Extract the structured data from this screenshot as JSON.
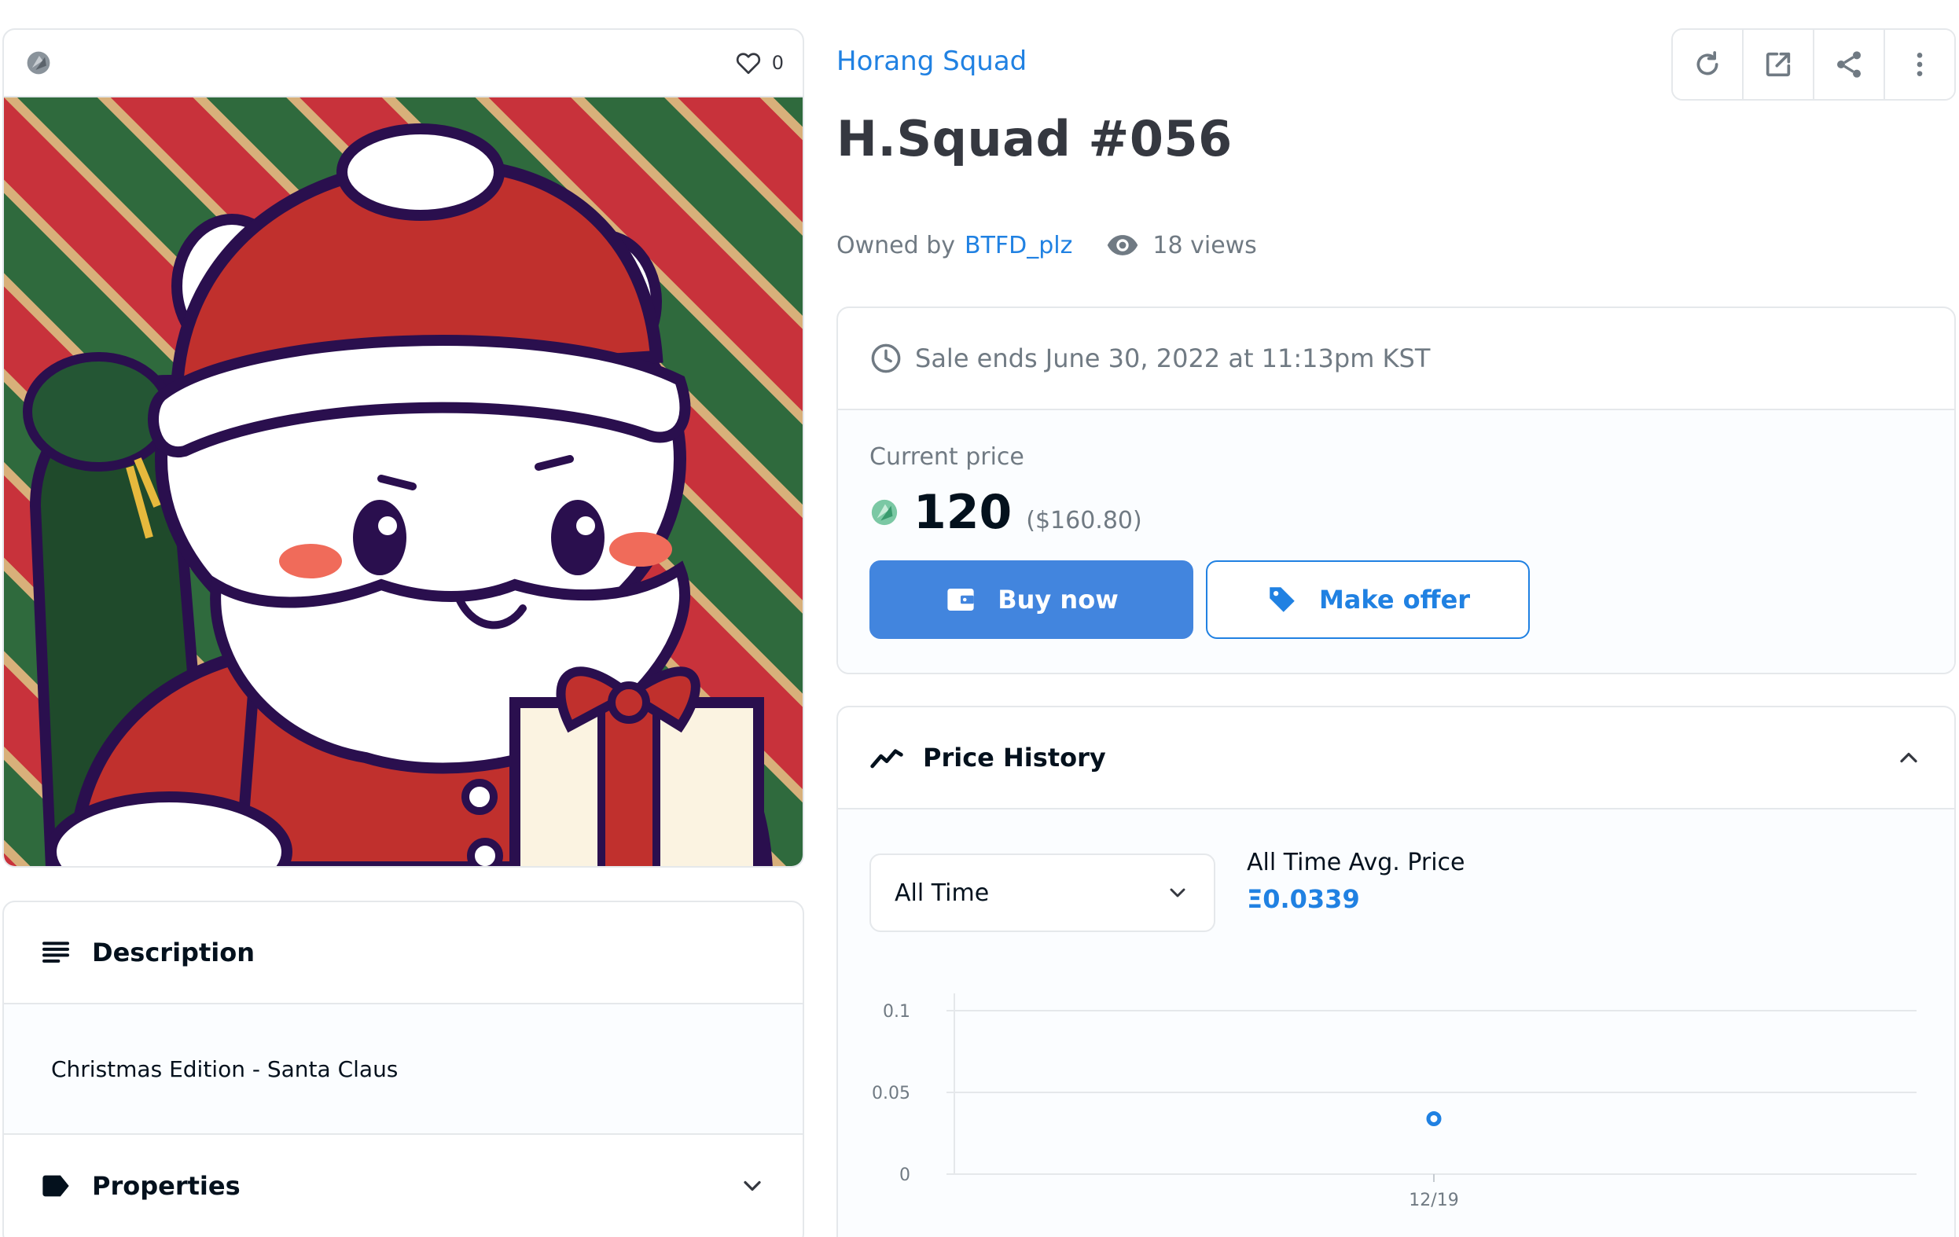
{
  "nft": {
    "favorites_count": "0"
  },
  "description": {
    "heading": "Description",
    "text": "Christmas Edition - Santa Claus"
  },
  "properties": {
    "heading": "Properties"
  },
  "collection": {
    "name": "Horang Squad"
  },
  "item": {
    "title": "H.Squad #056",
    "owned_by_label": "Owned by",
    "owner": "BTFD_plz",
    "views": "18 views"
  },
  "sale": {
    "ends_text": "Sale ends June 30, 2022 at 11:13pm KST",
    "current_price_label": "Current price",
    "price": "120",
    "price_fiat": "($160.80)",
    "buy_label": "Buy now",
    "offer_label": "Make offer"
  },
  "history": {
    "heading": "Price History",
    "range_selected": "All Time",
    "avg_label": "All Time Avg. Price",
    "avg_value": "Ξ0.0339"
  },
  "colors": {
    "accent": "#2081e2",
    "buy_button": "#4285de",
    "border": "#e5e8eb",
    "text_muted": "#707a83"
  },
  "chart_data": {
    "type": "scatter",
    "x": [
      "12/19"
    ],
    "y": [
      0.0339
    ],
    "yticks": [
      "0",
      "0.05",
      "0.1"
    ],
    "ylim": [
      0,
      0.1
    ],
    "xlabel": "",
    "ylabel": "",
    "grid": true
  }
}
